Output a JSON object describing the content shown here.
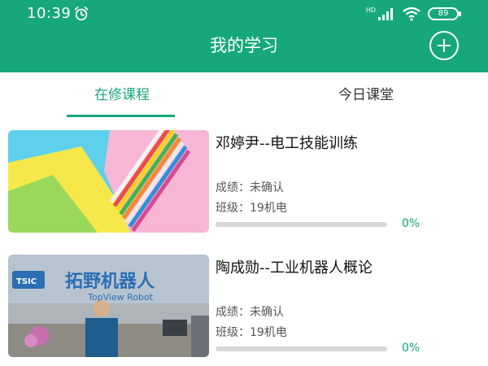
{
  "status_bar": {
    "time": "10:39",
    "network_label": "HD",
    "battery_level": "89",
    "icons": [
      "alarm-icon",
      "signal-icon",
      "wifi-icon",
      "battery-icon"
    ]
  },
  "header": {
    "title": "我的学习",
    "add_icon": "plus-circle-icon"
  },
  "tabs": [
    {
      "label": "在修课程",
      "active": true
    },
    {
      "label": "今日课堂",
      "active": false
    }
  ],
  "colors": {
    "accent": "#16a87b",
    "progress_track": "#d8d8d8"
  },
  "courses": [
    {
      "title": "邓婷尹--电工技能训练",
      "grade_label": "成绩：未确认",
      "class_label": "班级：19机电",
      "progress_text": "0%",
      "progress_value": 0,
      "thumbnail_icon": "colored-paper-image"
    },
    {
      "title": "陶成勋--工业机器人概论",
      "grade_label": "成绩：未确认",
      "class_label": "班级：19机电",
      "progress_text": "0%",
      "progress_value": 0,
      "thumbnail_icon": "robot-lab-photo",
      "thumbnail_sign": "拓野机器人",
      "thumbnail_sign_en": "TopView Robot",
      "thumbnail_logo": "TSIC"
    }
  ]
}
